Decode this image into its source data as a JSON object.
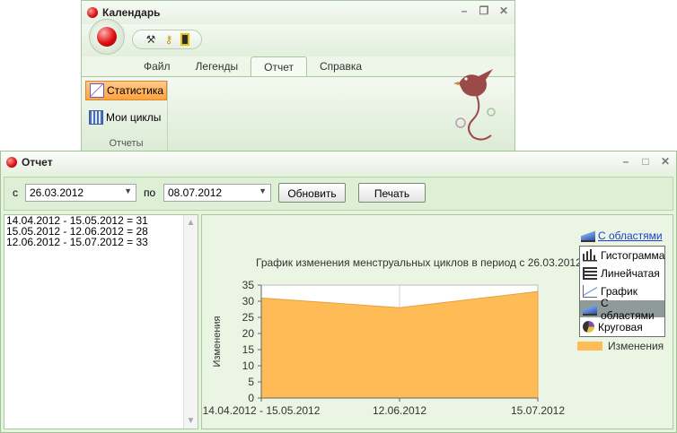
{
  "calendar_window": {
    "title": "Календарь",
    "tabs": [
      "Файл",
      "Легенды",
      "Отчет",
      "Справка"
    ],
    "active_tab": 2,
    "ribbon_buttons": [
      "Статистика",
      "Мои циклы"
    ],
    "group_label": "Отчеты"
  },
  "report_window": {
    "title": "Отчет",
    "toolbar": {
      "from_label": "с",
      "from_date": "26.03.2012",
      "to_label": "по",
      "to_date": "08.07.2012",
      "refresh_label": "Обновить",
      "print_label": "Печать"
    },
    "cycles_list": [
      "14.04.2012 - 15.05.2012 = 31",
      "15.05.2012 - 12.06.2012 = 28",
      "12.06.2012 - 15.07.2012 = 33"
    ],
    "chart_type_link": "С областями",
    "chart_type_menu": [
      "Гистограмма",
      "Линейчатая",
      "График",
      "С областями",
      "Круговая"
    ],
    "chart_type_selected": 3
  },
  "colors": {
    "area_fill": "#ffbb55",
    "panel_bg": "#eaf5e4",
    "ribbon_active": "#ffa23c"
  },
  "chart_data": {
    "type": "area",
    "title": "График изменения менструальных циклов в период с 26.03.2012 по 08",
    "categories": [
      "14.04.2012 - 15.05.2012",
      "12.06.2012",
      "15.07.2012"
    ],
    "series": [
      {
        "name": "Изменения",
        "values": [
          31,
          28,
          33
        ]
      }
    ],
    "ylabel": "Изменения",
    "xlabel": "",
    "ylim": [
      0,
      35
    ],
    "yticks": [
      0,
      5,
      10,
      15,
      20,
      25,
      30,
      35
    ],
    "grid": true,
    "legend": "right"
  }
}
